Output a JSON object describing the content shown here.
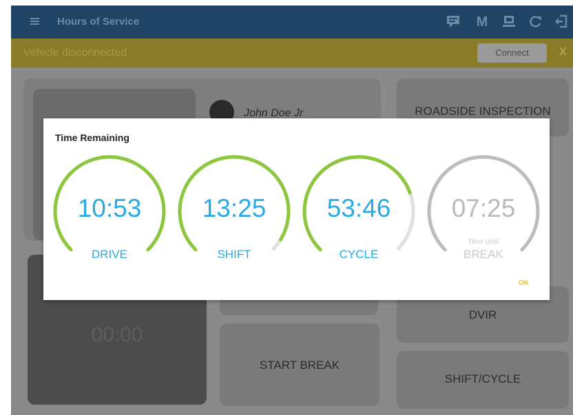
{
  "app": {
    "title": "Hours of Service"
  },
  "toolbar": {
    "icons": [
      "message-icon",
      "m-icon",
      "device-icon",
      "refresh-icon",
      "logout-icon"
    ],
    "m_label": "M"
  },
  "banner": {
    "text": "Vehicle disconnected",
    "connect_label": "Connect",
    "close_label": "X"
  },
  "driver": {
    "name": "John Doe Jr"
  },
  "background": {
    "timer": "00:00"
  },
  "buttons": {
    "roadside": "ROADSIDE INSPECTION",
    "dvir": "DVIR",
    "start_break": "START BREAK",
    "shift_cycle": "SHIFT/CYCLE"
  },
  "dialog": {
    "title": "Time Remaining",
    "ok_label": "OK",
    "gauges": [
      {
        "label": "DRIVE",
        "time": "10:53",
        "fraction": 1.0,
        "color": "#8dc63f"
      },
      {
        "label": "SHIFT",
        "time": "13:25",
        "fraction": 0.95,
        "color": "#8dc63f"
      },
      {
        "label": "CYCLE",
        "time": "53:46",
        "fraction": 0.76,
        "color": "#8dc63f"
      },
      {
        "label": "BREAK",
        "sublabel": "Time Until",
        "time": "07:25",
        "fraction": 1.0,
        "color": "#bdbdbd"
      }
    ]
  },
  "colors": {
    "appbar": "#1f4466",
    "banner": "#8a7b29",
    "accent": "#2aaae2",
    "ok": "#f2c230"
  }
}
